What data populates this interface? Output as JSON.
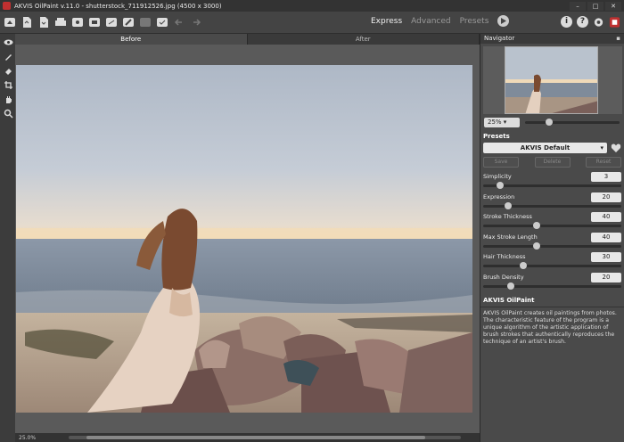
{
  "window": {
    "title": "AKVIS OilPaint v.11.0 - shutterstock_711912526.jpg (4500 x 3000)",
    "min": "–",
    "max": "□",
    "close": "✕"
  },
  "toolbar": {
    "modes": [
      {
        "label": "Express",
        "active": true
      },
      {
        "label": "Advanced",
        "active": false
      },
      {
        "label": "Presets",
        "active": false
      }
    ]
  },
  "view_tabs": [
    {
      "label": "Before",
      "active": true
    },
    {
      "label": "After",
      "active": false
    }
  ],
  "navigator": {
    "title": "Navigator",
    "zoom": "25%"
  },
  "status": {
    "zoom": "25.0%"
  },
  "presets": {
    "title": "Presets",
    "selected": "AKVIS Default",
    "buttons": {
      "save": "Save",
      "delete": "Delete",
      "reset": "Reset"
    }
  },
  "params": [
    {
      "label": "Simplicity",
      "value": "3",
      "frac": 0.12
    },
    {
      "label": "Expression",
      "value": "20",
      "frac": 0.18
    },
    {
      "label": "Stroke Thickness",
      "value": "40",
      "frac": 0.39
    },
    {
      "label": "Max Stroke Length",
      "value": "40",
      "frac": 0.39
    },
    {
      "label": "Hair Thickness",
      "value": "30",
      "frac": 0.29
    },
    {
      "label": "Brush Density",
      "value": "20",
      "frac": 0.2
    }
  ],
  "info": {
    "title": "AKVIS OilPaint",
    "text": "AKVIS OilPaint creates oil paintings from photos. The characteristic feature of the program is a unique algorithm of the artistic application of brush strokes that authentically reproduces the technique of an artist's brush."
  }
}
